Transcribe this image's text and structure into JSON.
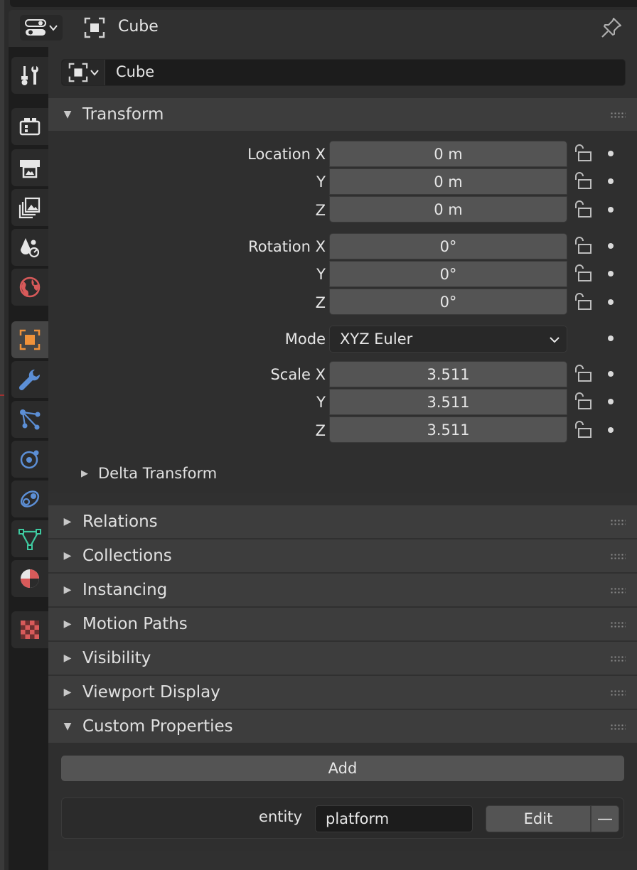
{
  "header": {
    "editor_type_icon": "properties-editor-icon",
    "object_icon": "object-icon",
    "title": "Cube",
    "pin_icon": "pin-icon"
  },
  "tabs": [
    {
      "name": "tool",
      "icon": "wrench-screwdriver-icon",
      "active": false
    },
    {
      "name": "render",
      "icon": "camera-back-icon",
      "active": false
    },
    {
      "name": "output",
      "icon": "printer-icon",
      "active": false
    },
    {
      "name": "view-layer",
      "icon": "images-icon",
      "active": false
    },
    {
      "name": "scene",
      "icon": "scene-icon",
      "active": false
    },
    {
      "name": "world",
      "icon": "world-icon",
      "active": false
    },
    {
      "name": "object",
      "icon": "object-icon",
      "active": true
    },
    {
      "name": "modifiers",
      "icon": "wrench-icon",
      "active": false
    },
    {
      "name": "particles",
      "icon": "particles-icon",
      "active": false
    },
    {
      "name": "physics",
      "icon": "physics-icon",
      "active": false
    },
    {
      "name": "constraints",
      "icon": "constraint-icon",
      "active": false
    },
    {
      "name": "data",
      "icon": "mesh-data-icon",
      "active": false
    },
    {
      "name": "material",
      "icon": "material-icon",
      "active": false
    },
    {
      "name": "texture",
      "icon": "checker-texture-icon",
      "active": false
    }
  ],
  "object_name": "Cube",
  "transform": {
    "title": "Transform",
    "location": {
      "label_x": "Location X",
      "label_y": "Y",
      "label_z": "Z",
      "x": "0 m",
      "y": "0 m",
      "z": "0 m"
    },
    "rotation": {
      "label_x": "Rotation X",
      "label_y": "Y",
      "label_z": "Z",
      "x": "0°",
      "y": "0°",
      "z": "0°"
    },
    "mode": {
      "label": "Mode",
      "value": "XYZ Euler"
    },
    "scale": {
      "label_x": "Scale X",
      "label_y": "Y",
      "label_z": "Z",
      "x": "3.511",
      "y": "3.511",
      "z": "3.511"
    },
    "delta": "Delta Transform"
  },
  "panels": {
    "relations": "Relations",
    "collections": "Collections",
    "instancing": "Instancing",
    "motion_paths": "Motion Paths",
    "visibility": "Visibility",
    "viewport_display": "Viewport Display",
    "custom_properties": "Custom Properties"
  },
  "custom_properties": {
    "add_label": "Add",
    "key": "entity",
    "value": "platform",
    "edit_label": "Edit",
    "remove_label": "—"
  },
  "colors": {
    "object_tab_accent": "#f0923a",
    "modifier_blue": "#5c8fd6",
    "world_red": "#d85a5a",
    "mesh_green": "#3fc9a0"
  }
}
